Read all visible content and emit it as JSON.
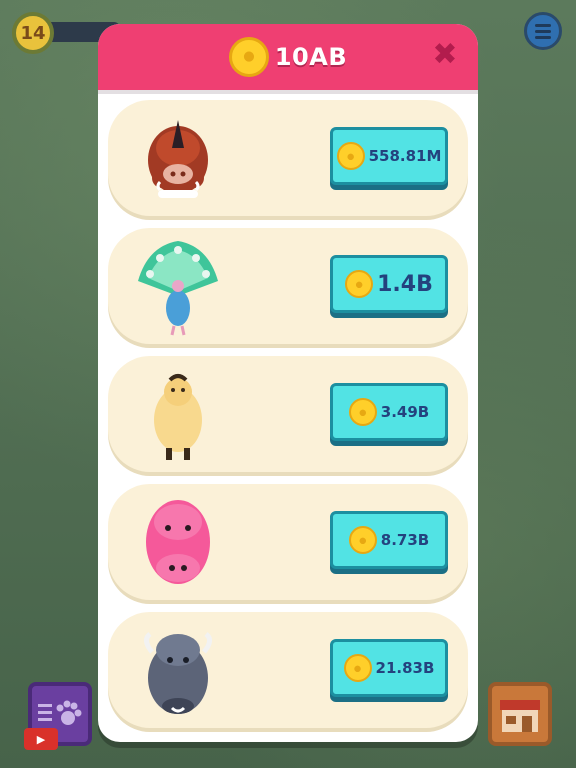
{
  "hud": {
    "level": "14"
  },
  "modal": {
    "balance": "10AB",
    "items": [
      {
        "animal": "boar",
        "price": "558.81M",
        "price_size": "small"
      },
      {
        "animal": "peacock",
        "price": "1.4B",
        "price_size": "big"
      },
      {
        "animal": "llama",
        "price": "3.49B",
        "price_size": "small"
      },
      {
        "animal": "hippo",
        "price": "8.73B",
        "price_size": "small"
      },
      {
        "animal": "buffalo",
        "price": "21.83B",
        "price_size": "small"
      }
    ]
  },
  "icons": {
    "coin": "paw-coin-icon",
    "close": "close-x-icon",
    "menu": "hamburger-menu-icon",
    "paw_list": "paw-list-icon",
    "youtube": "video-ad-icon",
    "shop": "shop-store-icon"
  },
  "colors": {
    "header": "#ef3f72",
    "button": "#52e3e4",
    "price_text": "#24427e",
    "card": "#fbf1d8"
  }
}
